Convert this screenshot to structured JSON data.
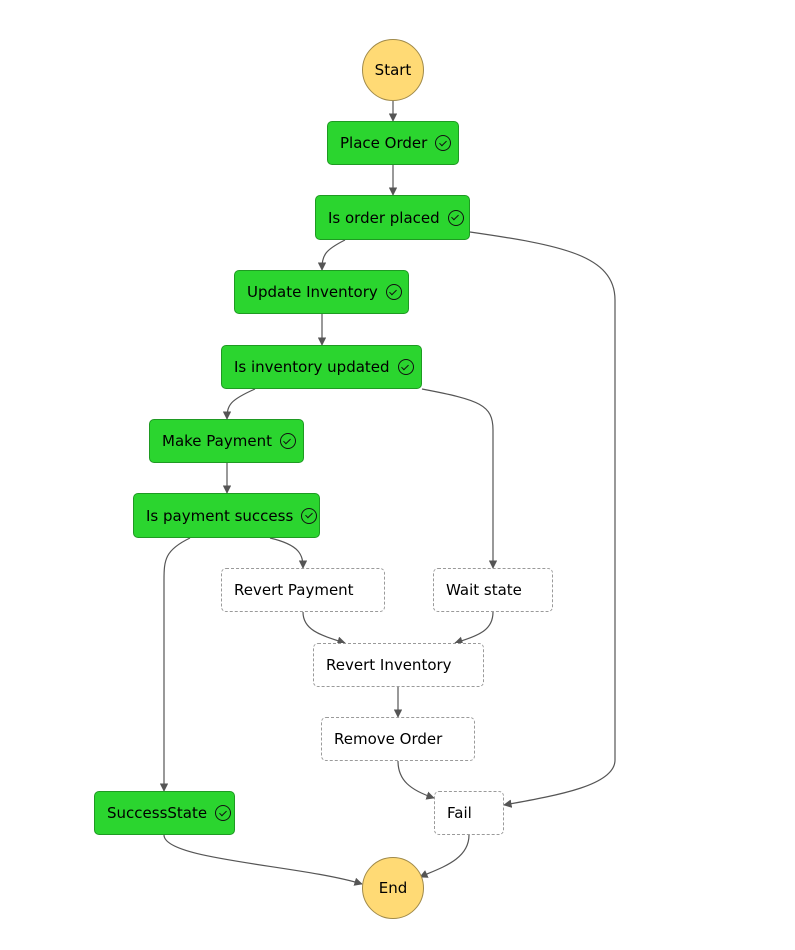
{
  "start_label": "Start",
  "end_label": "End",
  "colors": {
    "succeeded": "#2bd52f",
    "not_run": "#ffffff",
    "terminal": "#ffda75",
    "edge": "#555555"
  },
  "states": [
    {
      "label": "Place Order",
      "status": "succeeded",
      "icon": "check-circle-icon"
    },
    {
      "label": "Is order placed",
      "status": "succeeded",
      "icon": "check-circle-icon"
    },
    {
      "label": "Update Inventory",
      "status": "succeeded",
      "icon": "check-circle-icon"
    },
    {
      "label": "Is inventory updated",
      "status": "succeeded",
      "icon": "check-circle-icon"
    },
    {
      "label": "Make Payment",
      "status": "succeeded",
      "icon": "check-circle-icon"
    },
    {
      "label": "Is payment success",
      "status": "succeeded",
      "icon": "check-circle-icon"
    },
    {
      "label": "Revert Payment",
      "status": "not-run"
    },
    {
      "label": "Wait state",
      "status": "not-run"
    },
    {
      "label": "Revert Inventory",
      "status": "not-run"
    },
    {
      "label": "Remove Order",
      "status": "not-run"
    },
    {
      "label": "SuccessState",
      "status": "succeeded",
      "icon": "check-circle-icon"
    },
    {
      "label": "Fail",
      "status": "not-run"
    }
  ]
}
